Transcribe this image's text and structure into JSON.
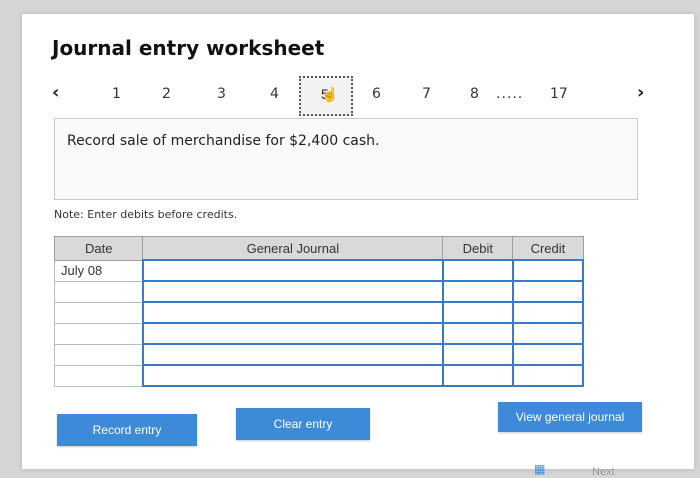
{
  "title": "Journal entry worksheet",
  "pager": {
    "prev_icon": "‹",
    "next_icon": "›",
    "pages": [
      "1",
      "2",
      "3",
      "4",
      "5",
      "6",
      "7",
      "8"
    ],
    "ellipsis": ".....",
    "last_page": "17",
    "active_page": "5"
  },
  "prompt": "Record sale of merchandise for $2,400 cash.",
  "note": "Note: Enter debits before credits.",
  "table": {
    "headers": {
      "date": "Date",
      "general_journal": "General Journal",
      "debit": "Debit",
      "credit": "Credit"
    },
    "rows": [
      {
        "date": "July 08",
        "account": "",
        "debit": "",
        "credit": ""
      },
      {
        "date": "",
        "account": "",
        "debit": "",
        "credit": ""
      },
      {
        "date": "",
        "account": "",
        "debit": "",
        "credit": ""
      },
      {
        "date": "",
        "account": "",
        "debit": "",
        "credit": ""
      },
      {
        "date": "",
        "account": "",
        "debit": "",
        "credit": ""
      },
      {
        "date": "",
        "account": "",
        "debit": "",
        "credit": ""
      }
    ]
  },
  "buttons": {
    "record_entry": "Record entry",
    "clear_entry": "Clear entry",
    "view_general_journal": "View general journal"
  },
  "footer": {
    "next_label": "Next"
  },
  "colors": {
    "accent": "#3c8ad8",
    "input_border": "#3a7bc8",
    "header_bg": "#d9d9d9"
  }
}
